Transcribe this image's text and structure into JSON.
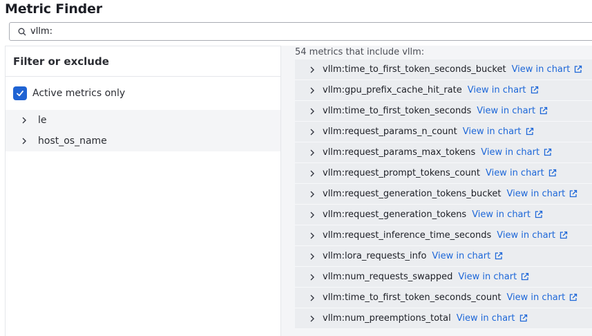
{
  "title": "Metric Finder",
  "search": {
    "value": "vllm:",
    "icon": "search-icon"
  },
  "filter_panel": {
    "heading": "Filter or exclude",
    "active_only_label": "Active metrics only",
    "active_only_checked": true,
    "filters": [
      {
        "label": "le"
      },
      {
        "label": "host_os_name"
      }
    ]
  },
  "results": {
    "count_text": "54 metrics that include vllm:",
    "link_label": "View in chart",
    "metrics": [
      {
        "name": "vllm:time_to_first_token_seconds_bucket"
      },
      {
        "name": "vllm:gpu_prefix_cache_hit_rate"
      },
      {
        "name": "vllm:time_to_first_token_seconds"
      },
      {
        "name": "vllm:request_params_n_count"
      },
      {
        "name": "vllm:request_params_max_tokens"
      },
      {
        "name": "vllm:request_prompt_tokens_count"
      },
      {
        "name": "vllm:request_generation_tokens_bucket"
      },
      {
        "name": "vllm:request_generation_tokens"
      },
      {
        "name": "vllm:request_inference_time_seconds"
      },
      {
        "name": "vllm:lora_requests_info"
      },
      {
        "name": "vllm:num_requests_swapped"
      },
      {
        "name": "vllm:time_to_first_token_seconds_count"
      },
      {
        "name": "vllm:num_preemptions_total"
      }
    ]
  },
  "colors": {
    "accent": "#1f63d3",
    "link": "#1d67d8",
    "row_bg": "#ebedf0",
    "panel_bg": "#f4f5f7"
  }
}
